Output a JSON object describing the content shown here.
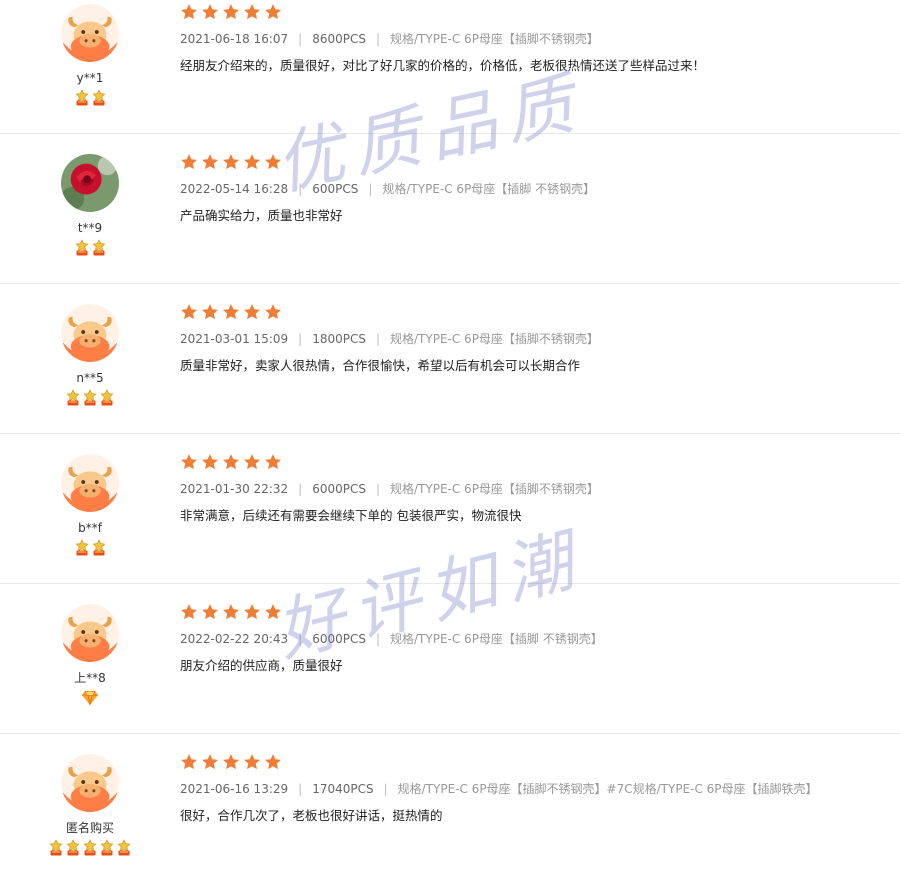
{
  "colors": {
    "star": "#f07d35",
    "avatar_bg": "#ff7e45",
    "ox_body": "#f9c98c",
    "badge_gold": "#e84c1a",
    "watermark": "#8a8fd4"
  },
  "reviews": [
    {
      "user": "y**1",
      "avatar": "ox-avatar-icon",
      "badges": 2,
      "badge_type": "crown-medal-icon",
      "rating": 5,
      "date": "2021-06-18 16:07",
      "qty": "8600PCS",
      "spec": "规格/TYPE-C 6P母座【插脚不锈钢壳】",
      "text": "经朋友介绍来的，质量很好，对比了好几家的价格的，价格低，老板很热情还送了些样品过来！"
    },
    {
      "user": "t**9",
      "avatar": "rose-photo-avatar",
      "badges": 2,
      "badge_type": "crown-medal-icon",
      "rating": 5,
      "date": "2022-05-14 16:28",
      "qty": "600PCS",
      "spec": "规格/TYPE-C 6P母座【插脚 不锈钢壳】",
      "text": "产品确实给力，质量也非常好"
    },
    {
      "user": "n**5",
      "avatar": "ox-avatar-icon",
      "badges": 3,
      "badge_type": "crown-medal-icon",
      "rating": 5,
      "date": "2021-03-01 15:09",
      "qty": "1800PCS",
      "spec": "规格/TYPE-C 6P母座【插脚不锈钢壳】",
      "text": "质量非常好，卖家人很热情，合作很愉快，希望以后有机会可以长期合作"
    },
    {
      "user": "b**f",
      "avatar": "ox-avatar-icon",
      "badges": 2,
      "badge_type": "crown-medal-icon",
      "rating": 5,
      "date": "2021-01-30 22:32",
      "qty": "6000PCS",
      "spec": "规格/TYPE-C 6P母座【插脚不锈钢壳】",
      "text": "非常满意，后续还有需要会继续下单的 包装很严实，物流很快"
    },
    {
      "user": "上**8",
      "avatar": "ox-avatar-icon",
      "badges": 1,
      "badge_type": "diamond-icon",
      "rating": 5,
      "date": "2022-02-22 20:43",
      "qty": "6000PCS",
      "spec": "规格/TYPE-C 6P母座【插脚 不锈钢壳】",
      "text": "朋友介绍的供应商，质量很好"
    },
    {
      "user": "匿名购买",
      "avatar": "ox-avatar-icon",
      "badges": 5,
      "badge_type": "crown-medal-icon",
      "rating": 5,
      "date": "2021-06-16 13:29",
      "qty": "17040PCS",
      "spec": "规格/TYPE-C 6P母座【插脚不锈钢壳】#7C规格/TYPE-C 6P母座【插脚铁壳】",
      "text": "很好，合作几次了，老板也很好讲话，挺热情的"
    }
  ],
  "watermarks": [
    "优质品质",
    "好评如潮"
  ]
}
